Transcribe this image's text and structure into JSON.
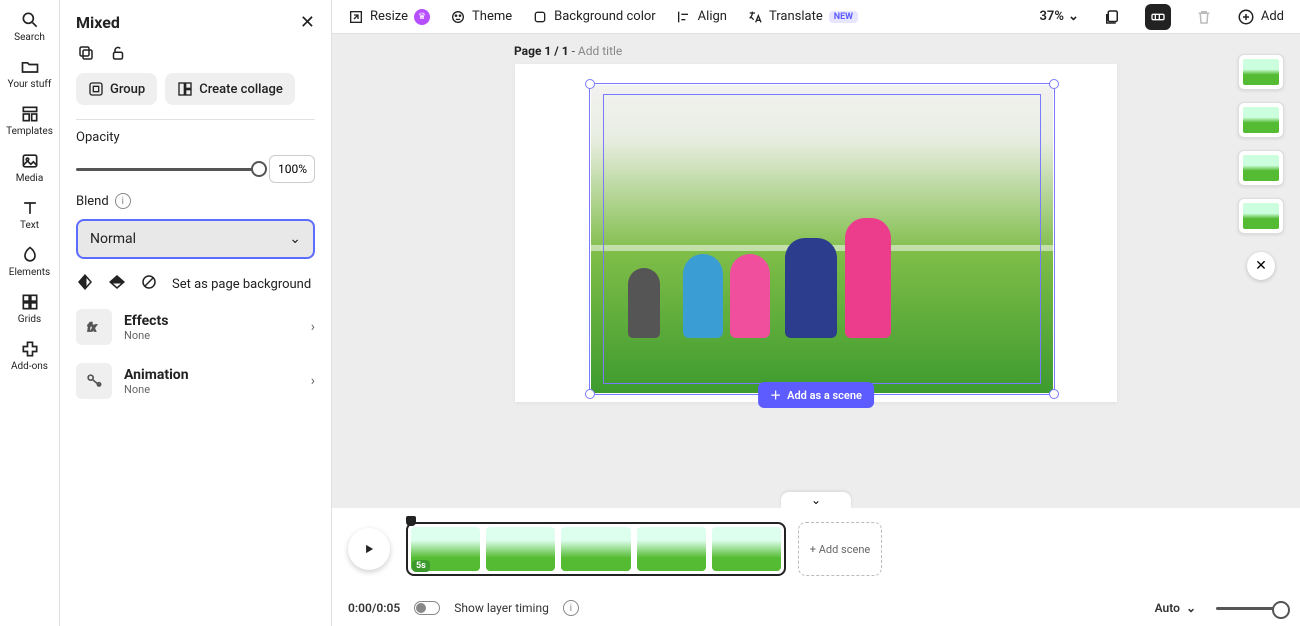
{
  "rail": {
    "search": "Search",
    "yourstuff": "Your stuff",
    "templates": "Templates",
    "media": "Media",
    "text": "Text",
    "elements": "Elements",
    "grids": "Grids",
    "addons": "Add-ons"
  },
  "panel": {
    "title": "Mixed",
    "group": "Group",
    "collage": "Create collage",
    "opacity_label": "Opacity",
    "opacity_value": "100%",
    "blend_label": "Blend",
    "blend_value": "Normal",
    "set_bg": "Set as page background",
    "effects": {
      "title": "Effects",
      "sub": "None"
    },
    "animation": {
      "title": "Animation",
      "sub": "None"
    }
  },
  "toolbar": {
    "resize": "Resize",
    "theme": "Theme",
    "bgcolor": "Background color",
    "align": "Align",
    "translate": "Translate",
    "new_badge": "NEW",
    "zoom": "37%",
    "add": "Add"
  },
  "page": {
    "prefix": "Page 1 / 1",
    "title_placeholder": "Add title"
  },
  "canvas": {
    "add_scene_btn": "Add as a scene"
  },
  "timeline": {
    "duration_badge": "5s",
    "add_scene": "+ Add scene",
    "time": "0:00/0:05",
    "show_layer": "Show layer timing",
    "auto": "Auto"
  }
}
